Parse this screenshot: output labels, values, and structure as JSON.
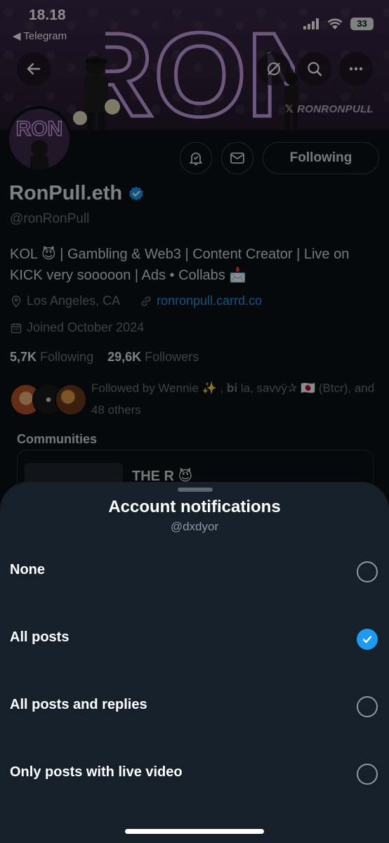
{
  "status_bar": {
    "time": "18.18",
    "back_app": "◀ Telegram",
    "battery": "33"
  },
  "banner": {
    "logo_text": "RON",
    "brand": "RONRONPULL",
    "brand_icon": "x-logo-icon"
  },
  "nav": {
    "back_icon": "arrow-left-icon",
    "mute_icon": "slash-circle-icon",
    "search_icon": "search-icon",
    "more_icon": "ellipsis-icon"
  },
  "profile": {
    "display_name": "RonPull.eth",
    "handle": "@ronRonPull",
    "bio": "KOL 😈 | Gambling & Web3 | Content Creator | Live on KICK very sooooon | Ads • Collabs 📩",
    "location": "Los Angeles, CA",
    "website": "ronronpull.carrd.co",
    "joined": "Joined October 2024",
    "following_count": "5,7K",
    "following_label": "Following",
    "followers_count": "29,6K",
    "followers_label": "Followers",
    "followed_by": "Followed by Wennie ✨ , 𝐛𝐢 la, savvÿ✰ 🇯🇵 (Btcr), and 48 others",
    "following_button": "Following",
    "communities_label": "Communities",
    "community_name": "THE R 😈"
  },
  "sheet": {
    "title": "Account notifications",
    "subtitle": "@dxdyor",
    "options": [
      {
        "label": "None",
        "selected": false
      },
      {
        "label": "All posts",
        "selected": true
      },
      {
        "label": "All posts and replies",
        "selected": false
      },
      {
        "label": "Only posts with live video",
        "selected": false
      }
    ]
  },
  "colors": {
    "accent": "#1d9bf0",
    "sheet_bg": "#15202b",
    "page_bg": "#0b0f14"
  }
}
